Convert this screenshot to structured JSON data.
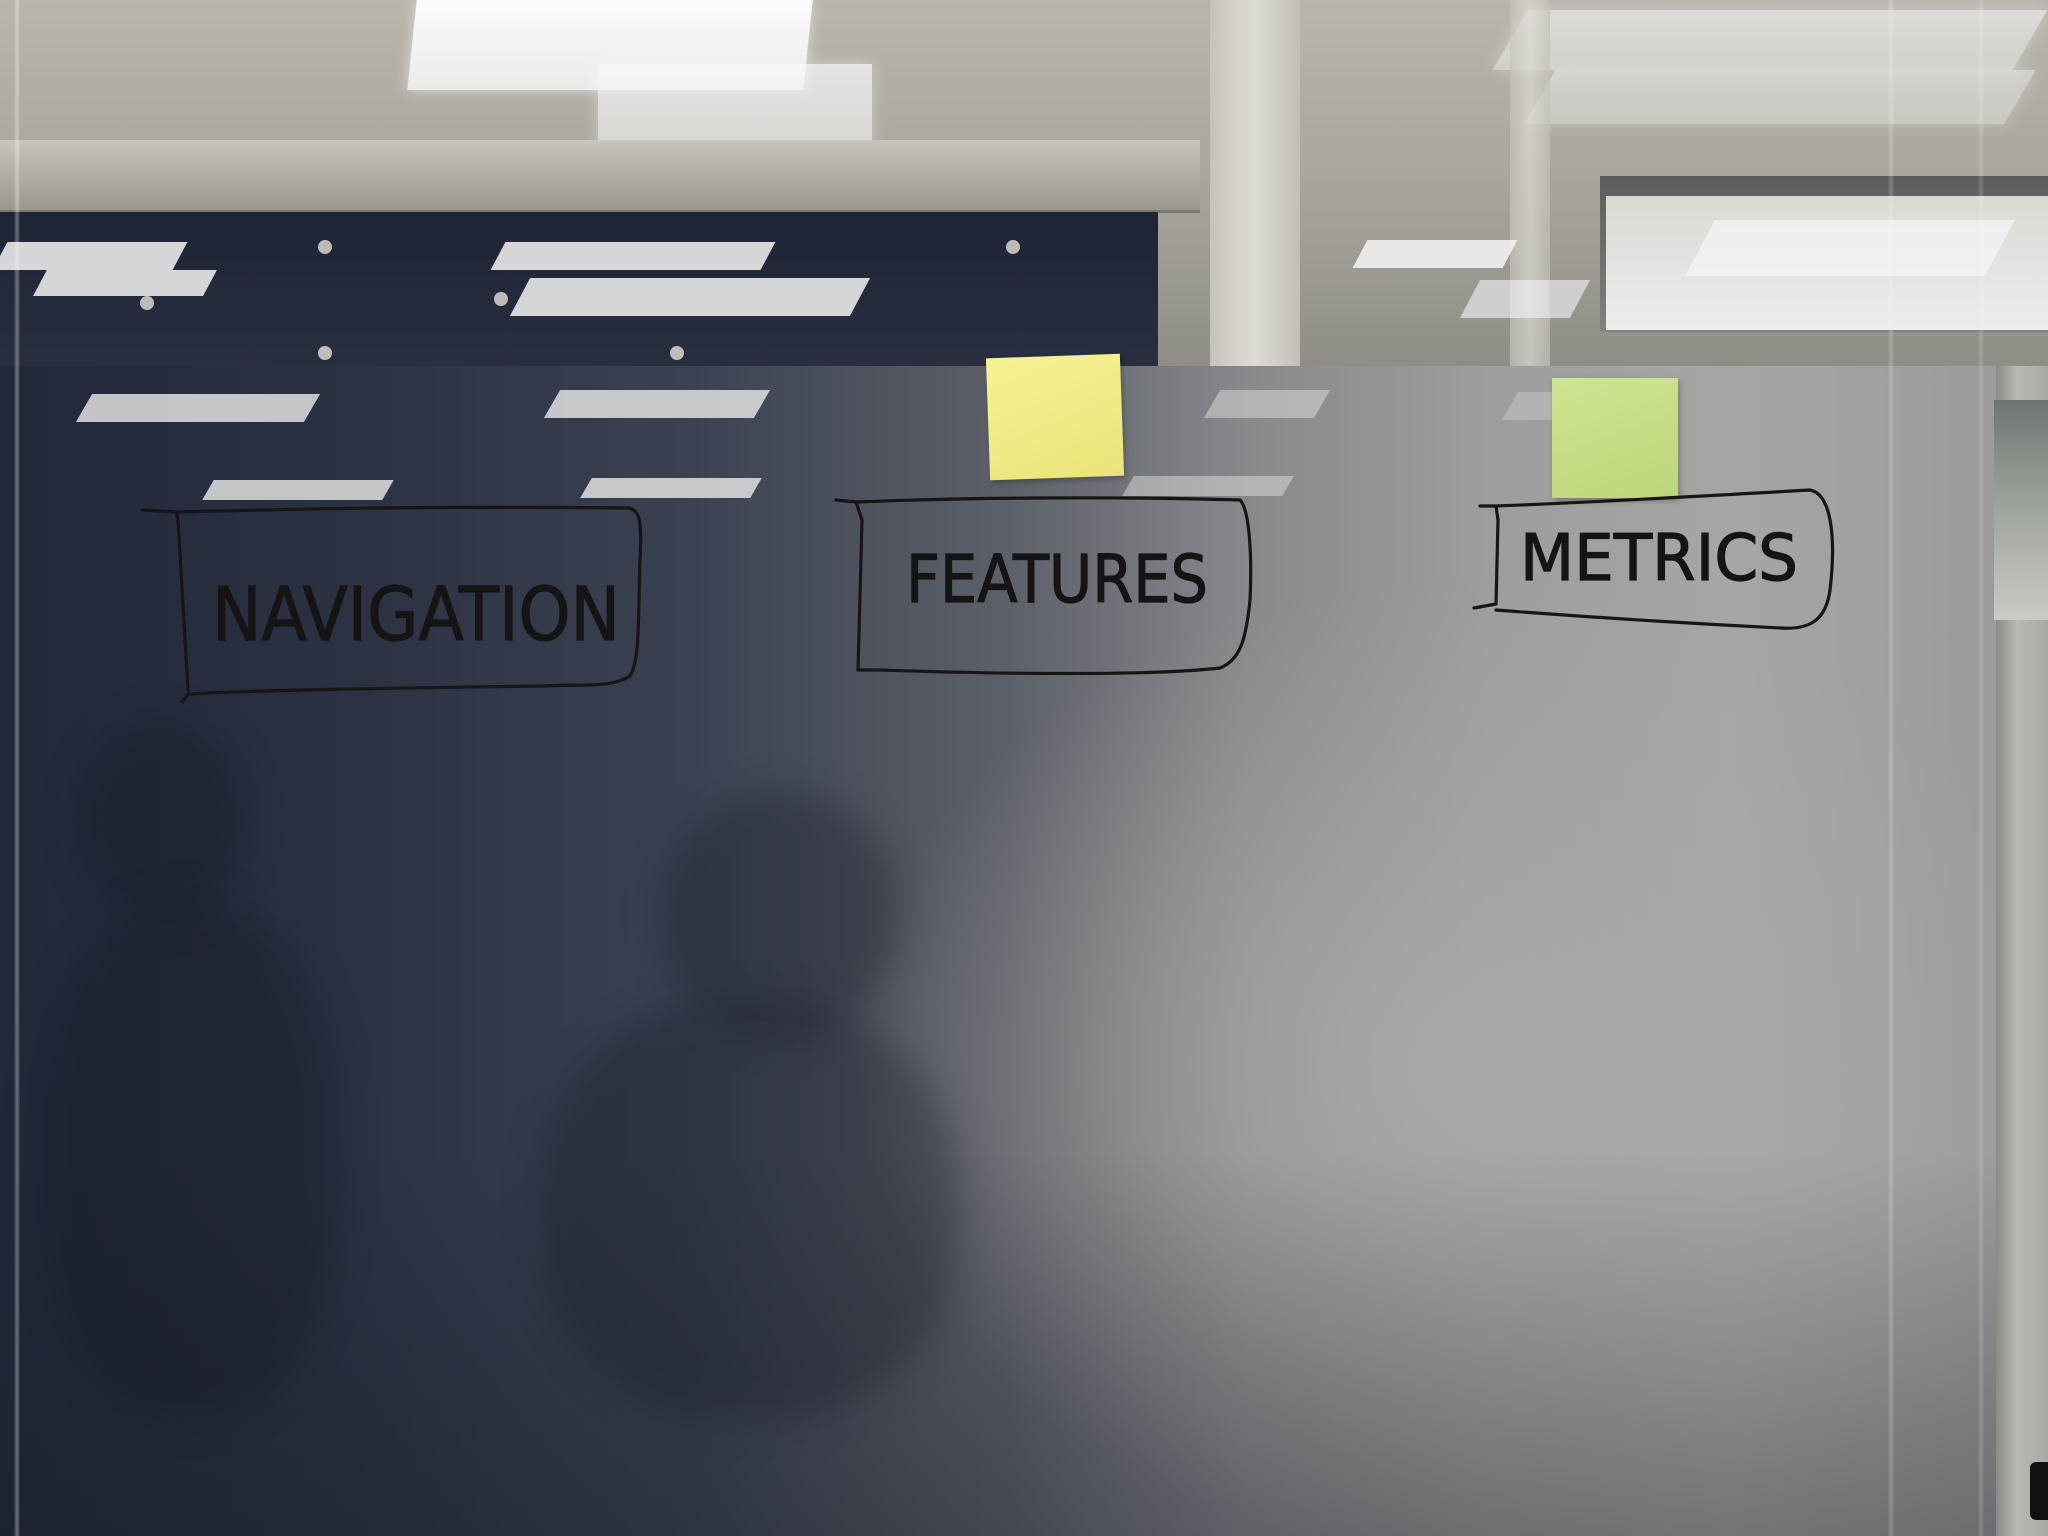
{
  "board": {
    "columns": [
      {
        "header": "NAVIGATION"
      },
      {
        "header": "FEATURES"
      },
      {
        "header": "METRICS"
      }
    ]
  },
  "sticky_notes": [
    {
      "color": "#f2ee8a"
    },
    {
      "color": "#c9e08a"
    }
  ],
  "colors": {
    "marker_ink": "#151515",
    "glass_dark": "#222838",
    "glass_light": "#a6a6a3"
  }
}
